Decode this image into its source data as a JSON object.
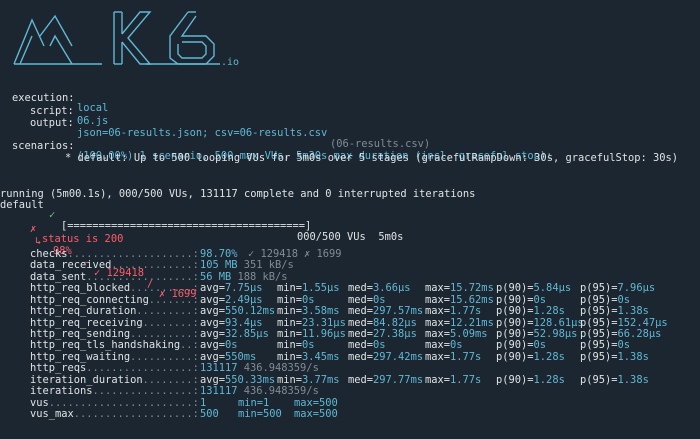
{
  "logo": {
    "text": "k6",
    "suffix": ".io"
  },
  "options": [
    {
      "key": "execution:",
      "value": "local",
      "extra": ""
    },
    {
      "key": "script:",
      "value": "06.js",
      "extra": ""
    },
    {
      "key": "output:",
      "value": "json=06-results.json; csv=06-results.csv",
      "extra": "(06-results.csv)"
    }
  ],
  "scenarios": {
    "key": "scenarios:",
    "summary": "(100.00%) 1 scenario, 500 max VUs, 5m30s max duration (incl. graceful stop):",
    "detail": "* default: Up to 500 looping VUs for 5m0s over 5 stages (gracefulRampDown: 30s, gracefulStop: 30s)"
  },
  "status": {
    "line1": "running (5m00.1s), 000/500 VUs, 131117 complete and 0 interrupted iterations",
    "name": "default",
    "check": "✓",
    "bar": "[======================================]",
    "tail": "000/500 VUs  5m0s"
  },
  "failed_check": {
    "mark": "✗",
    "label": "status is 200",
    "arrow": "↳",
    "pct": "98%",
    "sep1": "—",
    "ok": "✓ 129418",
    "sep2": "/",
    "fail": "✗ 1699"
  },
  "metrics": [
    {
      "name": "checks",
      "dots": "....................:",
      "main": "98.70%",
      "rest": [
        "✓ 129418",
        "✗ 1699"
      ],
      "kind": "checks"
    },
    {
      "name": "data_received",
      "dots": ".............:",
      "main": "105 MB",
      "rest": [
        "351 kB/s"
      ],
      "kind": "rate"
    },
    {
      "name": "data_sent",
      "dots": ".................:",
      "main": "56 MB",
      "rest": [
        "188 kB/s"
      ],
      "kind": "rate"
    },
    {
      "name": "http_req_blocked",
      "dots": "..........:",
      "trend": [
        "avg=7.75µs",
        "min=1.55µs",
        "med=3.66µs",
        "max=15.72ms",
        "p(90)=5.84µs",
        "p(95)=7.96µs"
      ]
    },
    {
      "name": "http_req_connecting",
      "dots": ".......:",
      "trend": [
        "avg=2.49µs",
        "min=0s",
        "med=0s",
        "max=15.62ms",
        "p(90)=0s",
        "p(95)=0s"
      ]
    },
    {
      "name": "http_req_duration",
      "dots": ".........:",
      "trend": [
        "avg=550.12ms",
        "min=3.58ms",
        "med=297.57ms",
        "max=1.77s",
        "p(90)=1.28s",
        "p(95)=1.38s"
      ]
    },
    {
      "name": "http_req_receiving",
      "dots": "........:",
      "trend": [
        "avg=93.4µs",
        "min=23.31µs",
        "med=84.82µs",
        "max=12.21ms",
        "p(90)=128.61µs",
        "p(95)=152.47µs"
      ]
    },
    {
      "name": "http_req_sending",
      "dots": "..........:",
      "trend": [
        "avg=32.85µs",
        "min=11.96µs",
        "med=27.38µs",
        "max=5.09ms",
        "p(90)=52.98µs",
        "p(95)=66.28µs"
      ]
    },
    {
      "name": "http_req_tls_handshaking",
      "dots": "..:",
      "trend": [
        "avg=0s",
        "min=0s",
        "med=0s",
        "max=0s",
        "p(90)=0s",
        "p(95)=0s"
      ]
    },
    {
      "name": "http_req_waiting",
      "dots": "..........:",
      "trend": [
        "avg=550ms",
        "min=3.45ms",
        "med=297.42ms",
        "max=1.77s",
        "p(90)=1.28s",
        "p(95)=1.38s"
      ]
    },
    {
      "name": "http_reqs",
      "dots": ".................:",
      "main": "131117",
      "rest": [
        "436.948359/s"
      ],
      "kind": "rate"
    },
    {
      "name": "iteration_duration",
      "dots": "........:",
      "trend": [
        "avg=550.33ms",
        "min=3.77ms",
        "med=297.77ms",
        "max=1.77s",
        "p(90)=1.28s",
        "p(95)=1.38s"
      ]
    },
    {
      "name": "iterations",
      "dots": "................:",
      "main": "131117",
      "rest": [
        "436.948359/s"
      ],
      "kind": "rate"
    },
    {
      "name": "vus",
      "dots": ".......................:",
      "main": "1",
      "rest": [
        "min=1",
        "max=500"
      ],
      "kind": "gauge"
    },
    {
      "name": "vus_max",
      "dots": "...................:",
      "main": "500",
      "rest": [
        "min=500",
        "max=500"
      ],
      "kind": "gauge"
    }
  ],
  "colors": {
    "background": "#1c2630",
    "accent": "#5fb8d6",
    "fail": "#ff5c6b",
    "pass": "#62c97f",
    "dim": "#7f8c96"
  }
}
